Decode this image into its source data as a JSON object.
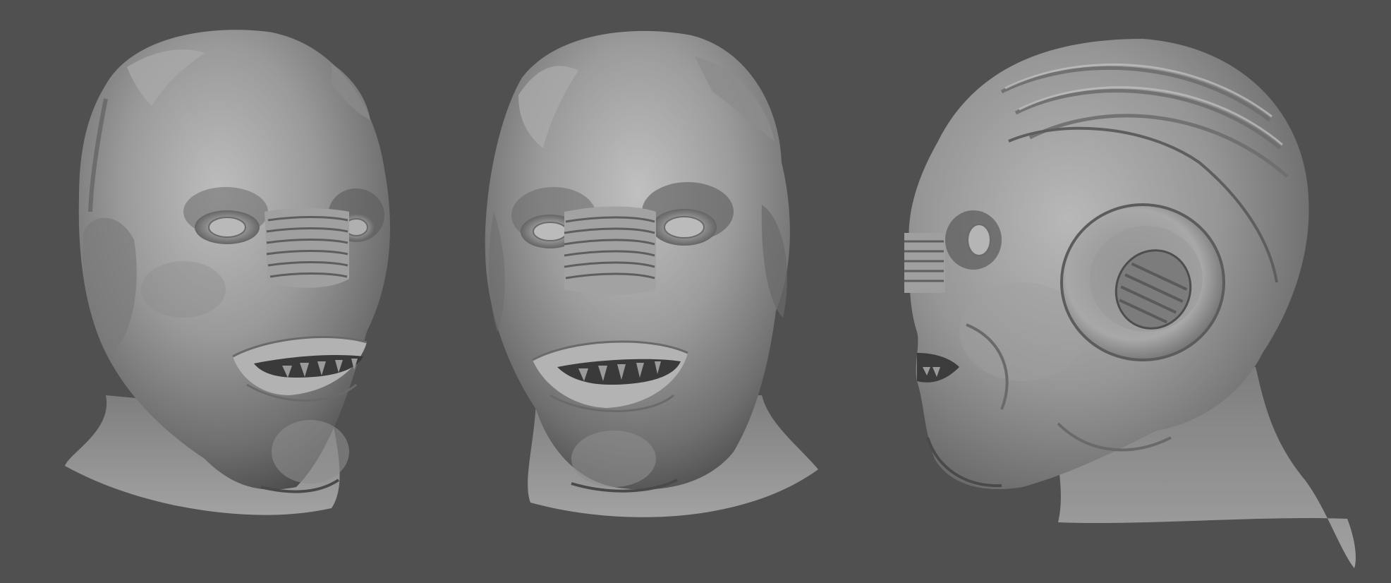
{
  "scene": {
    "subject": "alien-head-sculpt",
    "views": [
      {
        "id": "three-quarter-left-view"
      },
      {
        "id": "front-view"
      },
      {
        "id": "profile-right-view"
      }
    ]
  },
  "colors": {
    "background": "#505050",
    "clay_light": "#b0b0b0",
    "clay_mid": "#8a8a8a",
    "clay_dark": "#3c3c3c",
    "clay_shadow": "#2a2a2a"
  }
}
